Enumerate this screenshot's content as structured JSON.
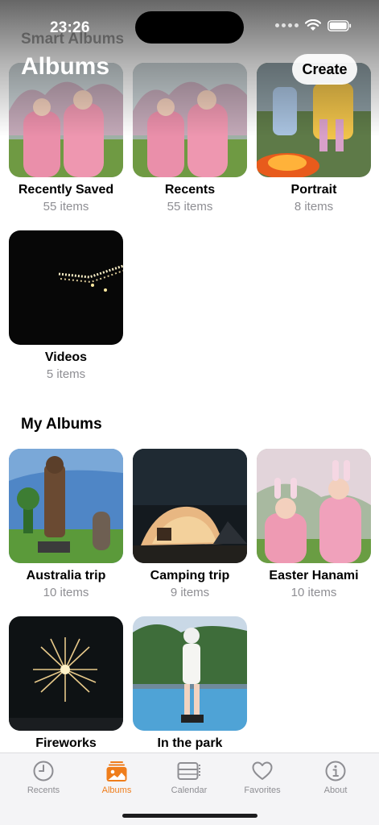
{
  "status": {
    "time": "23:26"
  },
  "header": {
    "smart_albums_title": "Smart Albums",
    "title": "Albums",
    "create_label": "Create"
  },
  "smart_albums": [
    {
      "name": "Recently Saved",
      "count": "55 items"
    },
    {
      "name": "Recents",
      "count": "55 items"
    },
    {
      "name": "Portrait",
      "count": "8 items"
    },
    {
      "name": "Videos",
      "count": "5 items"
    }
  ],
  "my_albums_title": "My Albums",
  "my_albums": [
    {
      "name": "Australia trip",
      "count": "10 items"
    },
    {
      "name": "Camping trip",
      "count": "9 items"
    },
    {
      "name": "Easter Hanami",
      "count": "10 items"
    },
    {
      "name": "Fireworks",
      "count": ""
    },
    {
      "name": "In the park",
      "count": ""
    }
  ],
  "tabs": [
    {
      "label": "Recents",
      "icon": "clock-icon"
    },
    {
      "label": "Albums",
      "icon": "photo-stack-icon",
      "active": true
    },
    {
      "label": "Calendar",
      "icon": "calendar-icon"
    },
    {
      "label": "Favorites",
      "icon": "heart-icon"
    },
    {
      "label": "About",
      "icon": "info-icon"
    }
  ],
  "colors": {
    "accent": "#ef7d1b",
    "secondary_text": "#8e8e93",
    "tab_bar_bg": "#f4f4f6"
  }
}
